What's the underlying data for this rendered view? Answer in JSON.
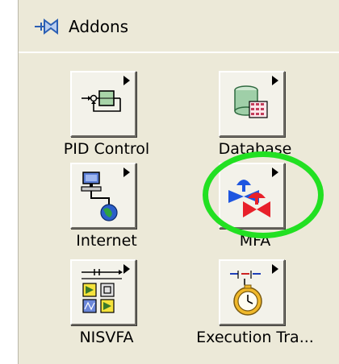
{
  "palette": {
    "title": "Addons",
    "icon": "palette-pin-icon"
  },
  "items": [
    {
      "label": "PID Control",
      "icon": "pid-control-icon"
    },
    {
      "label": "Database",
      "icon": "database-icon"
    },
    {
      "label": "Internet",
      "icon": "internet-icon"
    },
    {
      "label": "MFA",
      "icon": "mfa-icon"
    },
    {
      "label": "NISVFA",
      "icon": "nisvfa-icon"
    },
    {
      "label": "Execution Tra...",
      "icon": "execution-trace-icon"
    }
  ],
  "colors": {
    "highlight": "#22e022",
    "panel_bg": "#ece9d8",
    "header_bg": "#ece9d8"
  }
}
